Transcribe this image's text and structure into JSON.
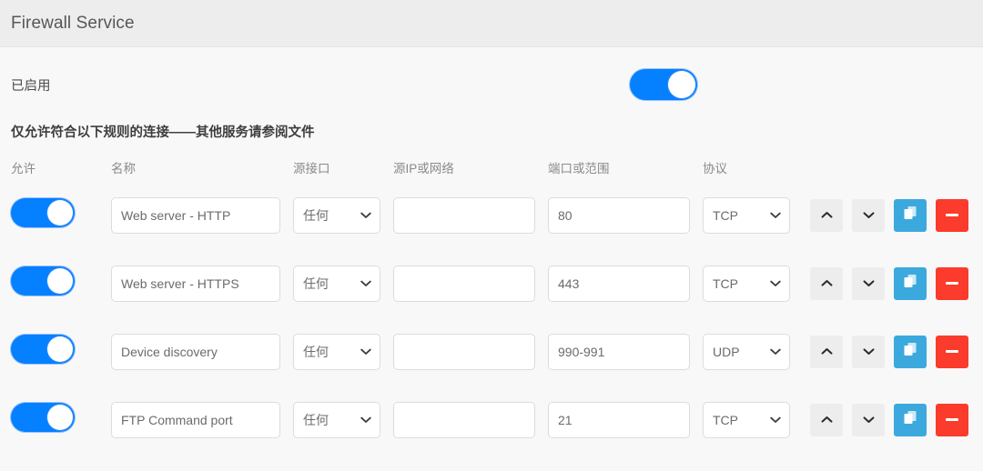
{
  "window": {
    "title": "Firewall Service"
  },
  "service": {
    "enabled_label": "已启用",
    "enabled": true,
    "toggle_on_color": "#0580ff"
  },
  "rules_section": {
    "description": "仅允许符合以下规则的连接——其他服务请参阅文件",
    "columns": {
      "allow": "允许",
      "name": "名称",
      "source_interface": "源接口",
      "source_ip": "源IP或网络",
      "port": "端口或范围",
      "protocol": "协议"
    },
    "actions": {
      "move_up": "move-up",
      "move_down": "move-down",
      "duplicate": "duplicate",
      "remove": "remove"
    },
    "action_colors": {
      "move": "#ededed",
      "duplicate": "#3ba9dd",
      "remove": "#fb3b2b"
    },
    "rows": [
      {
        "enabled": true,
        "name": "Web server - HTTP",
        "source_interface": "任何",
        "source_ip": "",
        "port": "80",
        "protocol": "TCP"
      },
      {
        "enabled": true,
        "name": "Web server - HTTPS",
        "source_interface": "任何",
        "source_ip": "",
        "port": "443",
        "protocol": "TCP"
      },
      {
        "enabled": true,
        "name": "Device discovery",
        "source_interface": "任何",
        "source_ip": "",
        "port": "990-991",
        "protocol": "UDP"
      },
      {
        "enabled": true,
        "name": "FTP Command port",
        "source_interface": "任何",
        "source_ip": "",
        "port": "21",
        "protocol": "TCP"
      }
    ]
  }
}
